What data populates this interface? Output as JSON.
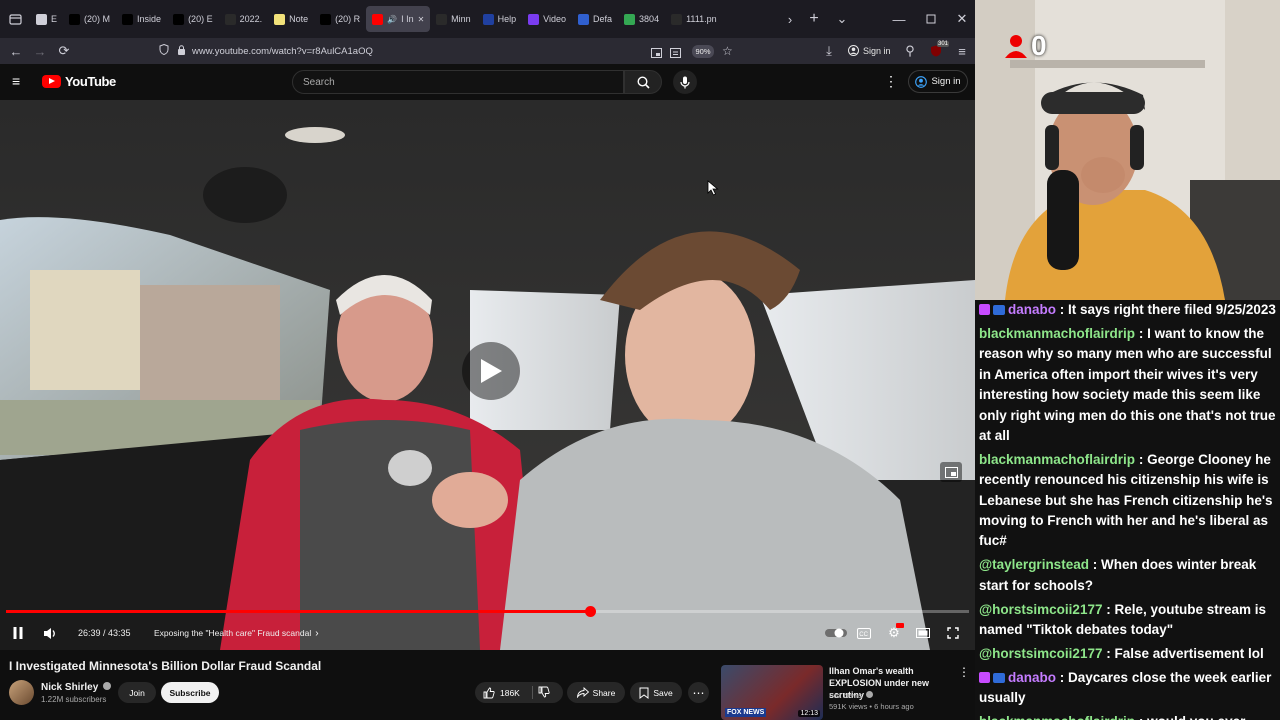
{
  "browser": {
    "tabs": [
      {
        "label": "E",
        "icon": "chevron-left-icon",
        "fav": "#cfcfd8"
      },
      {
        "label": "(20) M",
        "icon": "x-logo-icon",
        "fav": "#000"
      },
      {
        "label": "Inside",
        "icon": "nyt-logo-icon",
        "fav": "#000"
      },
      {
        "label": "(20) E",
        "icon": "x-logo-icon",
        "fav": "#000"
      },
      {
        "label": "2022.",
        "icon": "generic-page-icon",
        "fav": "#2a2a2a"
      },
      {
        "label": "Note",
        "icon": "notepad-icon",
        "fav": "#f2e27a"
      },
      {
        "label": "(20) R",
        "icon": "x-logo-icon",
        "fav": "#000"
      },
      {
        "label": "I In",
        "icon": "youtube-tab-icon",
        "fav": "#ff0000",
        "active": true
      },
      {
        "label": "Minn",
        "icon": "generic-page-icon",
        "fav": "#2a2a2a"
      },
      {
        "label": "Help",
        "icon": "help-page-icon",
        "fav": "#2040a0"
      },
      {
        "label": "Video",
        "icon": "video-page-icon",
        "fav": "#7a3cf0"
      },
      {
        "label": "Defa",
        "icon": "generic-page-icon",
        "fav": "#3060d0"
      },
      {
        "label": "3804",
        "icon": "maps-icon",
        "fav": "#34a853"
      },
      {
        "label": "1111.pn",
        "icon": "image-file-icon",
        "fav": "#2a2a2a"
      }
    ],
    "url": "www.youtube.com/watch?v=r8AulCA1aOQ",
    "zoom": "90%",
    "signin_label": "Sign in",
    "extension_badge": "301"
  },
  "youtube": {
    "logo_text": "YouTube",
    "search_placeholder": "Search",
    "signin_label": "Sign in"
  },
  "player": {
    "current_time": "26:39",
    "duration": "43:55",
    "time_display": "26:39 / 43:35",
    "chapter": "Exposing the \"Health care\" Fraud scandal",
    "progress": 0.6067
  },
  "video": {
    "title": "I Investigated Minnesota's Billion Dollar Fraud Scandal",
    "channel": "Nick Shirley",
    "subscribers": "1.22M subscribers",
    "join_label": "Join",
    "subscribe_label": "Subscribe",
    "likes": "186K",
    "share_label": "Share",
    "save_label": "Save"
  },
  "related": {
    "title": "Ilhan Omar's wealth EXPLOSION under new scrutiny",
    "channel": "Fox News",
    "meta": "591K views • 6 hours ago",
    "duration": "12:13",
    "thumb_label": "FOX NEWS"
  },
  "stream": {
    "counter": "0"
  },
  "chat": [
    {
      "user": "danabo",
      "text": "It says right there filed 9/25/2023",
      "badges": true,
      "color": "purple"
    },
    {
      "user": "blackmanmachoflairdrip",
      "text": "I want to know the reason why so many men who are successful in America often import their wives it's very interesting how society made this seem like only right wing men do this one that's not true at all",
      "badges": false,
      "color": "green"
    },
    {
      "user": "blackmanmachoflairdrip",
      "text": "George Clooney he recently renounced his citizenship his wife is Lebanese but she has French citizenship he's moving to French with her and he's liberal as fuc#",
      "badges": false,
      "color": "green"
    },
    {
      "user": "@taylergrinstead",
      "text": "When does winter break start for schools?",
      "badges": false,
      "color": "green"
    },
    {
      "user": "@horstsimcoii2177",
      "text": "Rele, youtube stream is named \"Tiktok debates today\"",
      "badges": false,
      "color": "green"
    },
    {
      "user": "@horstsimcoii2177",
      "text": "False advertisement lol",
      "badges": false,
      "color": "green"
    },
    {
      "user": "danabo",
      "text": "Daycares close the week earlier usually",
      "badges": true,
      "color": "purple"
    },
    {
      "user": "blackmanmachoflairdrip",
      "text": "would you ever import your wife?",
      "badges": false,
      "color": "green"
    }
  ]
}
